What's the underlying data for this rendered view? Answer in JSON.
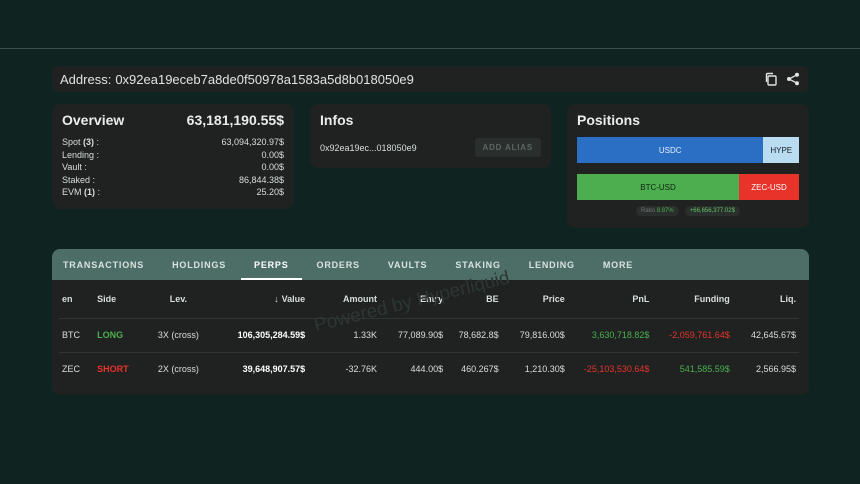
{
  "address": {
    "label": "Address:",
    "value": "0x92ea19eceb7a8de0f50978a1583a5d8b018050e9"
  },
  "overview": {
    "title": "Overview",
    "total": "63,181,190.55$",
    "rows": [
      {
        "label": "Spot",
        "count": "(3)",
        "suffix": " :",
        "value": "63,094,320.97$"
      },
      {
        "label": "Lending :",
        "count": "",
        "suffix": "",
        "value": "0.00$"
      },
      {
        "label": "Vault :",
        "count": "",
        "suffix": "",
        "value": "0.00$"
      },
      {
        "label": "Staked :",
        "count": "",
        "suffix": "",
        "value": "86,844.38$"
      },
      {
        "label": "EVM",
        "count": "(1)",
        "suffix": " :",
        "value": "25.20$"
      }
    ]
  },
  "infos": {
    "title": "Infos",
    "short_address": "0x92ea19ec...018050e9",
    "alias_button": "ADD ALIAS"
  },
  "positions": {
    "title": "Positions",
    "bar1": {
      "left": "USDC",
      "right": "HYPE",
      "left_share": 0.84
    },
    "bar2": {
      "left": "BTC-USD",
      "right": "ZEC-USD",
      "left_share": 0.73
    },
    "ratio_label": "Ratio",
    "ratio_value": "8.87%",
    "pnl_pill": "+66,656,377.02$"
  },
  "tabs": [
    "TRANSACTIONS",
    "HOLDINGS",
    "PERPS",
    "ORDERS",
    "VAULTS",
    "STAKING",
    "LENDING",
    "MORE"
  ],
  "active_tab": "PERPS",
  "table": {
    "headers": [
      "en",
      "Side",
      "Lev.",
      "Value",
      "Amount",
      "Entry",
      "BE",
      "Price",
      "PnL",
      "Funding",
      "Liq."
    ],
    "rows": [
      {
        "token": "BTC",
        "side": "LONG",
        "lev": "3X (cross)",
        "value": "106,305,284.59$",
        "amount": "1.33K",
        "entry": "77,089.90$",
        "be": "78,682.8$",
        "price": "79,816.00$",
        "pnl": "3,630,718.82$",
        "funding": "-2,059,761.64$",
        "liq": "42,645.67$"
      },
      {
        "token": "ZEC",
        "side": "SHORT",
        "lev": "2X (cross)",
        "value": "39,648,907.57$",
        "amount": "-32.76K",
        "entry": "444.00$",
        "be": "460.267$",
        "price": "1,210.30$",
        "pnl": "-25,103,530.64$",
        "funding": "541,585.59$",
        "liq": "2,566.95$"
      }
    ]
  },
  "watermark": "Powered by Hyperliquid",
  "colors": {
    "background": "#0f2420",
    "card": "#1f2221",
    "tabbar": "#4d6e66",
    "green": "#4caf50",
    "red": "#e8332b",
    "blue": "#2b6fc4"
  }
}
